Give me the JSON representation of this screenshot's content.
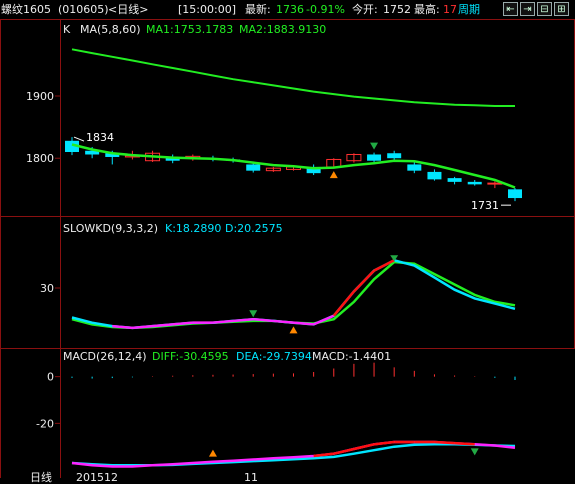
{
  "topbar": {
    "title": "螺纹1605",
    "code": "(010605)",
    "period": "<日线>",
    "time": "[15:00:00]",
    "latest_label": "最新:",
    "latest_value": "1736",
    "change_pct": "-0.91%",
    "open_label": "今开:",
    "open_value": "1752",
    "high_label": "最高:",
    "high_value": "17",
    "cycle_label": "周期",
    "buttons": [
      "⇤",
      "⇥",
      "⊟",
      "⊞"
    ]
  },
  "price_panel": {
    "k_label": "K",
    "ma_label": "MA(5,8,60)",
    "ma1": "MA1:1753.1783",
    "ma2": "MA2:1883.9130",
    "ticks": [
      "1900",
      "1800"
    ],
    "high_marker": "1834",
    "low_marker": "1731"
  },
  "kd_panel": {
    "title": "SLOWKD(9,3,3,2)",
    "k": "K:18.2890",
    "d": "D:20.2575",
    "ticks": [
      "30"
    ]
  },
  "macd_panel": {
    "title": "MACD(26,12,4)",
    "diff": "DIFF:-30.4595",
    "dea": "DEA:-29.7394",
    "macd": "MACD:-1.4401",
    "ticks": [
      "0",
      "-20"
    ]
  },
  "footer": {
    "label": "日线",
    "date1": "201512",
    "date2": "11"
  },
  "colors": {
    "border": "#8a1010",
    "up": "#ff3030",
    "down": "#00e5ff",
    "ma_green": "#22ee22",
    "kd_k": "#00e5ff",
    "kd_d": "#22ee22",
    "macd_diff": "#ff1010",
    "macd_dea": "#ff22ff",
    "text_yellow": "#ffff00",
    "text_green": "#22ee22",
    "text_cyan": "#00e5ff"
  },
  "chart_data": [
    {
      "type": "candlestick",
      "title": "",
      "ylim": [
        1720,
        1990
      ],
      "yticks": [
        1900,
        1800
      ],
      "candles": [
        {
          "o": 1828,
          "c": 1810,
          "h": 1834,
          "l": 1805
        },
        {
          "o": 1812,
          "c": 1806,
          "h": 1818,
          "l": 1800
        },
        {
          "o": 1808,
          "c": 1802,
          "h": 1812,
          "l": 1790
        },
        {
          "o": 1802,
          "c": 1804,
          "h": 1812,
          "l": 1798
        },
        {
          "o": 1796,
          "c": 1808,
          "h": 1812,
          "l": 1794
        },
        {
          "o": 1802,
          "c": 1796,
          "h": 1806,
          "l": 1792
        },
        {
          "o": 1800,
          "c": 1803,
          "h": 1806,
          "l": 1796
        },
        {
          "o": 1800,
          "c": 1798,
          "h": 1804,
          "l": 1795
        },
        {
          "o": 1798,
          "c": 1796,
          "h": 1801,
          "l": 1793
        },
        {
          "o": 1790,
          "c": 1780,
          "h": 1793,
          "l": 1777
        },
        {
          "o": 1780,
          "c": 1784,
          "h": 1786,
          "l": 1778
        },
        {
          "o": 1782,
          "c": 1786,
          "h": 1789,
          "l": 1780
        },
        {
          "o": 1786,
          "c": 1776,
          "h": 1790,
          "l": 1773
        },
        {
          "o": 1786,
          "c": 1798,
          "h": 1800,
          "l": 1784
        },
        {
          "o": 1796,
          "c": 1806,
          "h": 1808,
          "l": 1793
        },
        {
          "o": 1806,
          "c": 1796,
          "h": 1809,
          "l": 1790
        },
        {
          "o": 1808,
          "c": 1800,
          "h": 1812,
          "l": 1794
        },
        {
          "o": 1790,
          "c": 1780,
          "h": 1794,
          "l": 1776
        },
        {
          "o": 1778,
          "c": 1766,
          "h": 1782,
          "l": 1764
        },
        {
          "o": 1768,
          "c": 1762,
          "h": 1770,
          "l": 1758
        },
        {
          "o": 1762,
          "c": 1758,
          "h": 1765,
          "l": 1756
        },
        {
          "o": 1760,
          "c": 1760,
          "h": 1763,
          "l": 1752
        },
        {
          "o": 1750,
          "c": 1736,
          "h": 1752,
          "l": 1731
        }
      ],
      "ma1": [
        1822,
        1814,
        1808,
        1805,
        1803,
        1801,
        1800,
        1799,
        1797,
        1793,
        1789,
        1787,
        1784,
        1785,
        1789,
        1792,
        1796,
        1795,
        1789,
        1781,
        1773,
        1765,
        1753
      ],
      "ma2": [
        1975,
        1969,
        1963,
        1957,
        1951,
        1945,
        1939,
        1933,
        1927,
        1922,
        1917,
        1912,
        1907,
        1903,
        1899,
        1896,
        1893,
        1890,
        1888,
        1886,
        1885,
        1884,
        1884
      ]
    },
    {
      "type": "line",
      "title": "",
      "ylim": [
        0,
        60
      ],
      "yticks": [
        30
      ],
      "series": [
        {
          "name": "K",
          "values": [
            13,
            10,
            8,
            7,
            8,
            9,
            10,
            10,
            11,
            12,
            11,
            10,
            9,
            14,
            28,
            40,
            46,
            43,
            36,
            29,
            24,
            21,
            18
          ]
        },
        {
          "name": "D",
          "values": [
            12,
            9,
            7.5,
            7,
            7.5,
            8.5,
            9.5,
            10,
            10.5,
            11,
            11,
            10,
            9.5,
            12,
            22,
            35,
            45,
            44,
            38,
            32,
            26,
            22,
            20
          ]
        }
      ]
    },
    {
      "type": "line",
      "title": "",
      "ylim": [
        -40,
        2
      ],
      "yticks": [
        0,
        -20
      ],
      "series": [
        {
          "name": "DIFF",
          "values": [
            -37,
            -38,
            -38.5,
            -38.5,
            -38,
            -37.5,
            -37,
            -36.5,
            -36,
            -35.5,
            -35,
            -34.5,
            -34,
            -33,
            -31,
            -29,
            -28,
            -28,
            -28,
            -28.5,
            -29,
            -29.5,
            -30.5
          ]
        },
        {
          "name": "DEA",
          "values": [
            -37,
            -37.5,
            -38,
            -38,
            -38,
            -37.8,
            -37.4,
            -37,
            -36.6,
            -36.2,
            -35.8,
            -35.4,
            -35,
            -34.4,
            -33,
            -31.5,
            -30,
            -29.2,
            -29,
            -29,
            -29.2,
            -29.5,
            -29.7
          ]
        }
      ],
      "macd": [
        -0.5,
        -0.8,
        -0.6,
        -0.3,
        0.2,
        0.4,
        0.6,
        0.8,
        0.9,
        1.1,
        1.3,
        1.4,
        2.0,
        3.5,
        5.5,
        6.0,
        4.0,
        2.5,
        1.0,
        0.5,
        0.2,
        -0.5,
        -1.44
      ]
    }
  ]
}
